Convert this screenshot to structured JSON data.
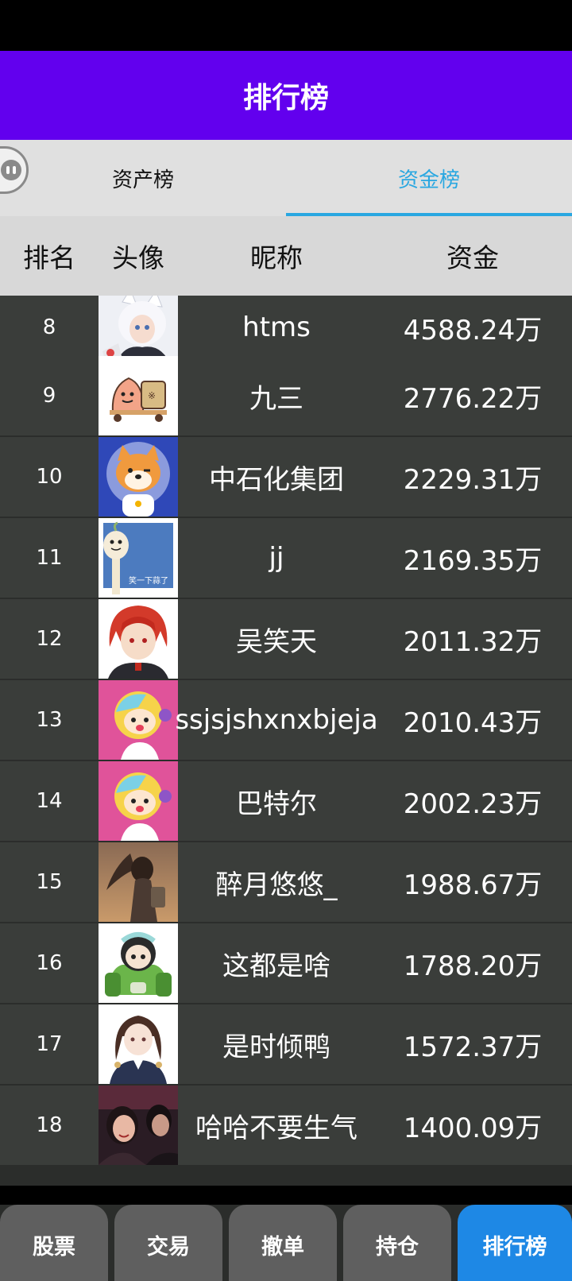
{
  "title": "排行榜",
  "tabs": [
    {
      "label": "资产榜",
      "active": false
    },
    {
      "label": "资金榜",
      "active": true
    }
  ],
  "columns": {
    "rank": "排名",
    "avatar": "头像",
    "nickname": "昵称",
    "funds": "资金"
  },
  "rows": [
    {
      "rank": "8",
      "nickname": "htms",
      "funds": "4588.24万",
      "avatar": "white-fox-girl-avatar"
    },
    {
      "rank": "9",
      "nickname": "九三",
      "funds": "2776.22万",
      "avatar": "patrick-spongebob-avatar"
    },
    {
      "rank": "10",
      "nickname": "中石化集团",
      "funds": "2229.31万",
      "avatar": "shiba-astronaut-avatar"
    },
    {
      "rank": "11",
      "nickname": "jj",
      "funds": "2169.35万",
      "avatar": "smiling-garlic-avatar"
    },
    {
      "rank": "12",
      "nickname": "吴笑天",
      "funds": "2011.32万",
      "avatar": "red-hair-character-avatar"
    },
    {
      "rank": "13",
      "nickname": "ssjsjshxnxbjeja",
      "funds": "2010.43万",
      "avatar": "pink-cartoon-avatar"
    },
    {
      "rank": "14",
      "nickname": "巴特尔",
      "funds": "2002.23万",
      "avatar": "pink-cartoon-avatar"
    },
    {
      "rank": "15",
      "nickname": "醉月悠悠_",
      "funds": "1988.67万",
      "avatar": "girl-windy-hair-avatar"
    },
    {
      "rank": "16",
      "nickname": "这都是啥",
      "funds": "1788.20万",
      "avatar": "green-mech-avatar"
    },
    {
      "rank": "17",
      "nickname": "是时倾鸭",
      "funds": "1572.37万",
      "avatar": "anime-girl-uniform-avatar"
    },
    {
      "rank": "18",
      "nickname": "哈哈不要生气",
      "funds": "1400.09万",
      "avatar": "movie-couple-avatar"
    }
  ],
  "avatar_texts": {
    "garlic_caption": "笑一下蒜了"
  },
  "bottom_nav": [
    {
      "label": "股票",
      "active": false
    },
    {
      "label": "交易",
      "active": false
    },
    {
      "label": "撤单",
      "active": false
    },
    {
      "label": "持仓",
      "active": false
    },
    {
      "label": "排行榜",
      "active": true
    }
  ],
  "colors": {
    "title_bar": "#6200EE",
    "tab_active": "#29A7E1",
    "nav_active": "#1E88E5",
    "row_bg": "#3A3D3A"
  }
}
